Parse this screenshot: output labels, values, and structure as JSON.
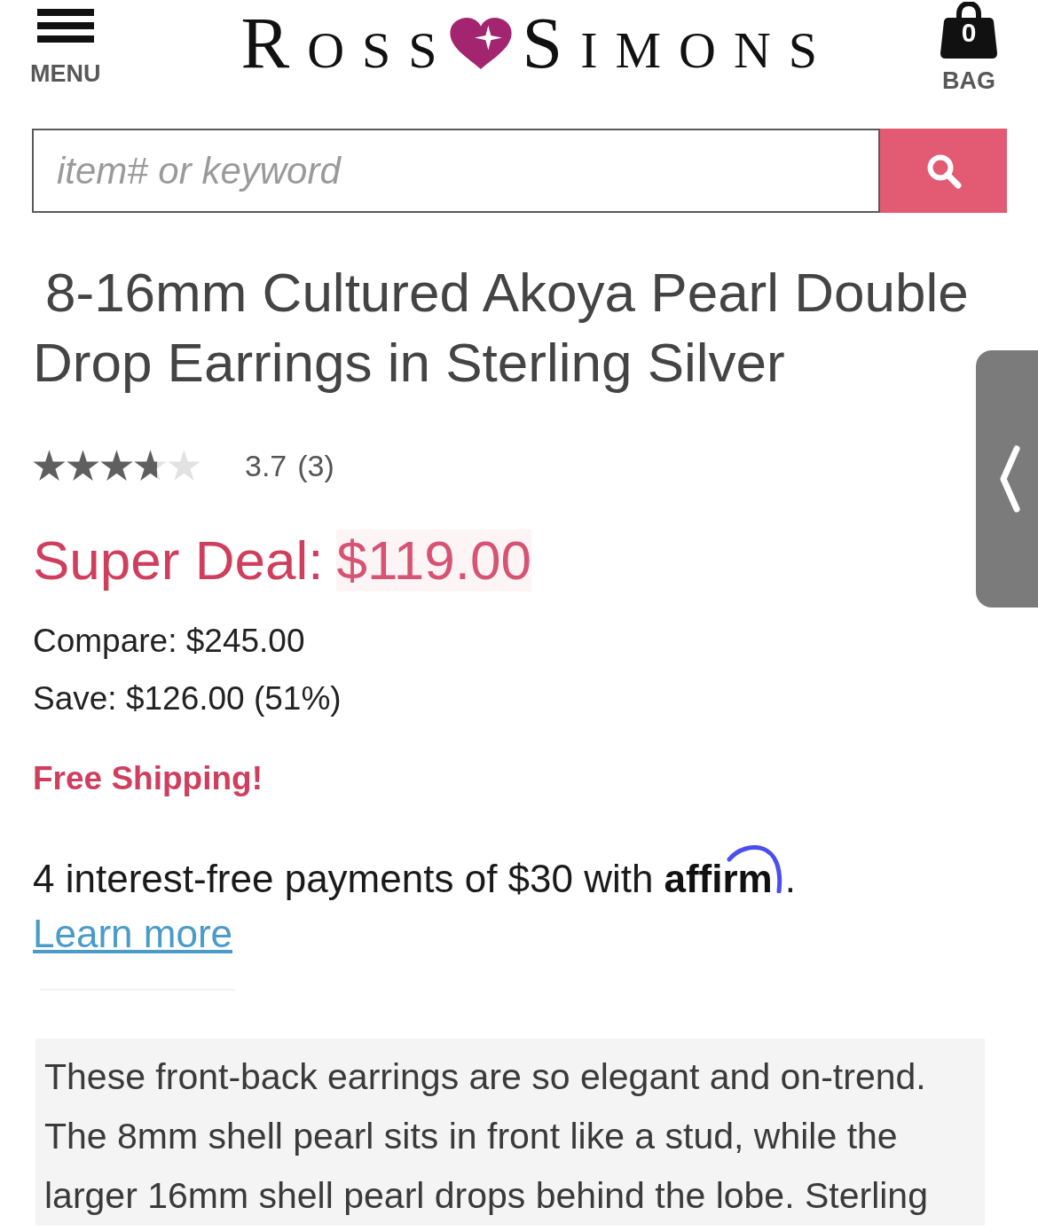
{
  "header": {
    "menu": {
      "label": "MENU"
    },
    "logo": {
      "left": "ROSS",
      "right": "SIMONS"
    },
    "bag": {
      "label": "BAG",
      "count": "0"
    }
  },
  "search": {
    "placeholder": "item# or keyword"
  },
  "product": {
    "title": "8-16mm Cultured Akoya Pearl Double Drop Earrings in Sterling Silver",
    "rating": {
      "stars": 3.7,
      "score": "3.7",
      "count": "(3)"
    },
    "price": {
      "label": "Super Deal:",
      "amount": "$119.00"
    },
    "compare": "Compare: $245.00",
    "save": "Save: $126.00 (51%)",
    "shipping": "Free Shipping!",
    "financing": {
      "text": "4 interest-free payments of $30 with",
      "provider": "affirm",
      "suffix": ".",
      "link": "Learn more"
    },
    "description": "These front-back earrings are so elegant and on-trend. The 8mm shell pearl sits in front like a stud, while the larger 16mm shell pearl drops behind the lobe. Sterling"
  }
}
